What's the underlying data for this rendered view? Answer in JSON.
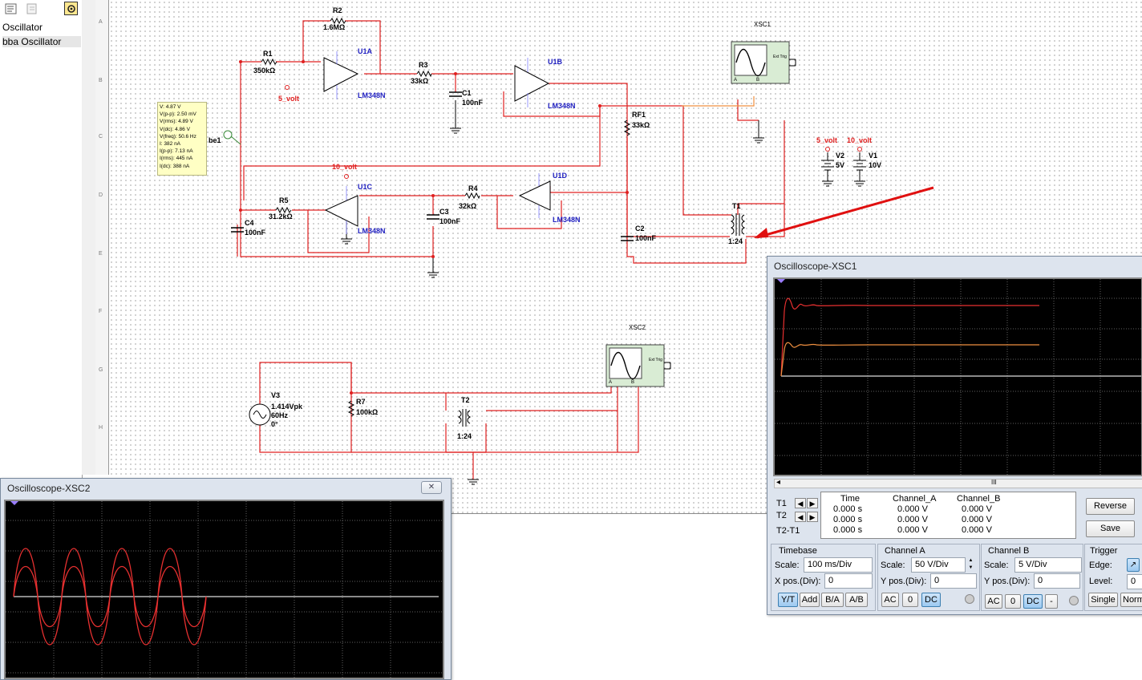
{
  "design_tree": {
    "items": [
      "Oscillator",
      "bba Oscillator"
    ]
  },
  "ruler_rows": [
    "A",
    "B",
    "C",
    "D",
    "E",
    "F",
    "G",
    "H"
  ],
  "probe": {
    "name": "be1",
    "lines": [
      "V: 4.87 V",
      "V(p-p): 2.50 mV",
      "V(rms): 4.89 V",
      "V(dc): 4.86 V",
      "V(freq): 50.6 Hz",
      "I: 382 nA",
      "I(p-p): 7.13 nA",
      "I(rms): 445 nA",
      "I(dc): 388 nA"
    ]
  },
  "schematic": {
    "R2": {
      "name": "R2",
      "value": "1.6MΩ"
    },
    "R1": {
      "name": "R1",
      "value": "350kΩ"
    },
    "R3": {
      "name": "R3",
      "value": "33kΩ"
    },
    "C1": {
      "name": "C1",
      "value": "100nF"
    },
    "RF1": {
      "name": "RF1",
      "value": "33kΩ"
    },
    "R5": {
      "name": "R5",
      "value": "31.2kΩ"
    },
    "R4": {
      "name": "R4",
      "value": "32kΩ"
    },
    "C3": {
      "name": "C3",
      "value": "100nF"
    },
    "C4": {
      "name": "C4",
      "value": "100nF"
    },
    "C2": {
      "name": "C2",
      "value": "100nF"
    },
    "U1A": {
      "name": "U1A",
      "part": "LM348N"
    },
    "U1B": {
      "name": "U1B",
      "part": "LM348N"
    },
    "U1C": {
      "name": "U1C",
      "part": "LM348N"
    },
    "U1D": {
      "name": "U1D",
      "part": "LM348N"
    },
    "net_5v": "5_volt",
    "net_10v": "10_volt",
    "V2": {
      "name": "V2",
      "value": "5V"
    },
    "V1": {
      "name": "V1",
      "value": "10V"
    },
    "T1": {
      "name": "T1",
      "ratio": "1:24"
    },
    "T2": {
      "name": "T2",
      "ratio": "1:24"
    },
    "V3": {
      "name": "V3",
      "amp": "1.414Vpk",
      "freq": "60Hz",
      "phase": "0°"
    },
    "R7": {
      "name": "R7",
      "value": "100kΩ"
    },
    "XSC1": "XSC1",
    "XSC2": "XSC2",
    "ext_trig": "Ext Trig",
    "pin_a": "A",
    "pin_b": "B"
  },
  "xsc2_window": {
    "title": "Oscilloscope-XSC2",
    "close_icon": "x-icon"
  },
  "xsc1_window": {
    "title": "Oscilloscope-XSC1",
    "scroll_marker": "III",
    "readout": {
      "headers": [
        "Time",
        "Channel_A",
        "Channel_B"
      ],
      "rows": [
        {
          "label": "T1",
          "time": "0.000 s",
          "a": "0.000 V",
          "b": "0.000 V"
        },
        {
          "label": "T2",
          "time": "0.000 s",
          "a": "0.000 V",
          "b": "0.000 V"
        },
        {
          "label": "T2-T1",
          "time": "0.000 s",
          "a": "0.000 V",
          "b": "0.000 V"
        }
      ]
    },
    "buttons": {
      "reverse": "Reverse",
      "save": "Save"
    },
    "timebase": {
      "title": "Timebase",
      "scale_label": "Scale:",
      "scale": "100 ms/Div",
      "xpos_label": "X pos.(Div):",
      "xpos": "0",
      "modes": [
        "Y/T",
        "Add",
        "B/A",
        "A/B"
      ]
    },
    "channel_a": {
      "title": "Channel A",
      "scale_label": "Scale:",
      "scale": "50  V/Div",
      "ypos_label": "Y pos.(Div):",
      "ypos": "0",
      "coupling": [
        "AC",
        "0",
        "DC"
      ]
    },
    "channel_b": {
      "title": "Channel B",
      "scale_label": "Scale:",
      "scale": "5  V/Div",
      "ypos_label": "Y pos.(Div):",
      "ypos": "0",
      "coupling": [
        "AC",
        "0",
        "DC",
        "-"
      ]
    },
    "trigger": {
      "title": "Trigger",
      "edge_label": "Edge:",
      "level_label": "Level:",
      "level": "0",
      "single": "Single",
      "normal": "Norm"
    }
  },
  "colors": {
    "wire": "#e02020",
    "component_blue": "#2020c0",
    "trace_a": "#e83030",
    "trace_b": "#f09040",
    "annotation_arrow": "#e01010"
  }
}
